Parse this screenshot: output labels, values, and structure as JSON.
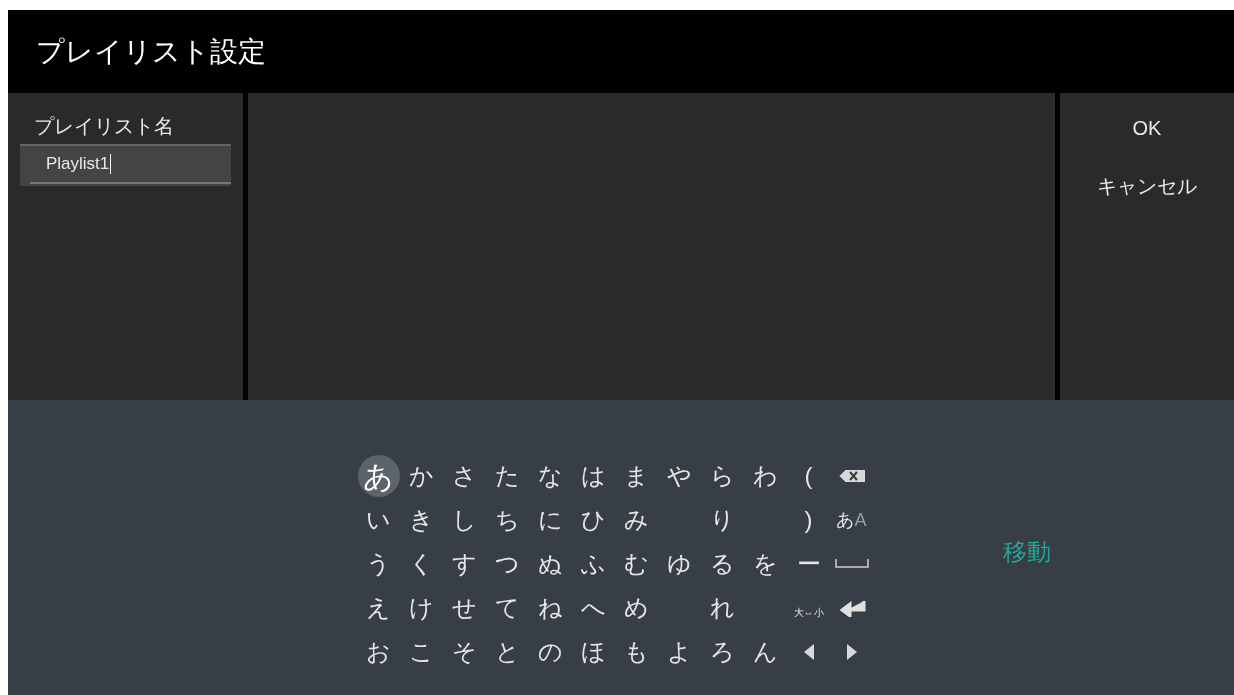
{
  "title": "プレイリスト設定",
  "name_field": {
    "label": "プレイリスト名",
    "value": "Playlist1",
    "focused": true
  },
  "actions": [
    {
      "label": "OK"
    },
    {
      "label": "キャンセル"
    }
  ],
  "keyboard": {
    "rows": [
      [
        {
          "kind": "char",
          "label": "あ",
          "selected": true
        },
        {
          "kind": "char",
          "label": "か",
          "selected": false
        },
        {
          "kind": "char",
          "label": "さ",
          "selected": false
        },
        {
          "kind": "char",
          "label": "た",
          "selected": false
        },
        {
          "kind": "char",
          "label": "な",
          "selected": false
        },
        {
          "kind": "char",
          "label": "は",
          "selected": false
        },
        {
          "kind": "char",
          "label": "ま",
          "selected": false
        },
        {
          "kind": "char",
          "label": "や",
          "selected": false
        },
        {
          "kind": "char",
          "label": "ら",
          "selected": false
        },
        {
          "kind": "char",
          "label": "わ",
          "selected": false
        },
        {
          "kind": "char",
          "label": "(",
          "selected": false
        },
        {
          "kind": "backspace"
        }
      ],
      [
        {
          "kind": "char",
          "label": "い",
          "selected": false
        },
        {
          "kind": "char",
          "label": "き",
          "selected": false
        },
        {
          "kind": "char",
          "label": "し",
          "selected": false
        },
        {
          "kind": "char",
          "label": "ち",
          "selected": false
        },
        {
          "kind": "char",
          "label": "に",
          "selected": false
        },
        {
          "kind": "char",
          "label": "ひ",
          "selected": false
        },
        {
          "kind": "char",
          "label": "み",
          "selected": false
        },
        {
          "kind": "empty"
        },
        {
          "kind": "char",
          "label": "り",
          "selected": false
        },
        {
          "kind": "empty"
        },
        {
          "kind": "char",
          "label": ")",
          "selected": false
        },
        {
          "kind": "mode",
          "label": "あ",
          "alt": "A"
        }
      ],
      [
        {
          "kind": "char",
          "label": "う",
          "selected": false
        },
        {
          "kind": "char",
          "label": "く",
          "selected": false
        },
        {
          "kind": "char",
          "label": "す",
          "selected": false
        },
        {
          "kind": "char",
          "label": "つ",
          "selected": false
        },
        {
          "kind": "char",
          "label": "ぬ",
          "selected": false
        },
        {
          "kind": "char",
          "label": "ふ",
          "selected": false
        },
        {
          "kind": "char",
          "label": "む",
          "selected": false
        },
        {
          "kind": "char",
          "label": "ゆ",
          "selected": false
        },
        {
          "kind": "char",
          "label": "る",
          "selected": false
        },
        {
          "kind": "char",
          "label": "を",
          "selected": false
        },
        {
          "kind": "char",
          "label": "ー",
          "selected": false
        },
        {
          "kind": "space"
        }
      ],
      [
        {
          "kind": "char",
          "label": "え",
          "selected": false
        },
        {
          "kind": "char",
          "label": "け",
          "selected": false
        },
        {
          "kind": "char",
          "label": "せ",
          "selected": false
        },
        {
          "kind": "char",
          "label": "て",
          "selected": false
        },
        {
          "kind": "char",
          "label": "ね",
          "selected": false
        },
        {
          "kind": "char",
          "label": "へ",
          "selected": false
        },
        {
          "kind": "char",
          "label": "め",
          "selected": false
        },
        {
          "kind": "empty"
        },
        {
          "kind": "char",
          "label": "れ",
          "selected": false
        },
        {
          "kind": "empty"
        },
        {
          "kind": "case",
          "label": "大⇔小"
        },
        {
          "kind": "enter"
        }
      ],
      [
        {
          "kind": "char",
          "label": "お",
          "selected": false
        },
        {
          "kind": "char",
          "label": "こ",
          "selected": false
        },
        {
          "kind": "char",
          "label": "そ",
          "selected": false
        },
        {
          "kind": "char",
          "label": "と",
          "selected": false
        },
        {
          "kind": "char",
          "label": "の",
          "selected": false
        },
        {
          "kind": "char",
          "label": "ほ",
          "selected": false
        },
        {
          "kind": "char",
          "label": "も",
          "selected": false
        },
        {
          "kind": "char",
          "label": "よ",
          "selected": false
        },
        {
          "kind": "char",
          "label": "ろ",
          "selected": false
        },
        {
          "kind": "char",
          "label": "ん",
          "selected": false
        },
        {
          "kind": "left"
        },
        {
          "kind": "right"
        }
      ]
    ],
    "side_label": "移動"
  }
}
